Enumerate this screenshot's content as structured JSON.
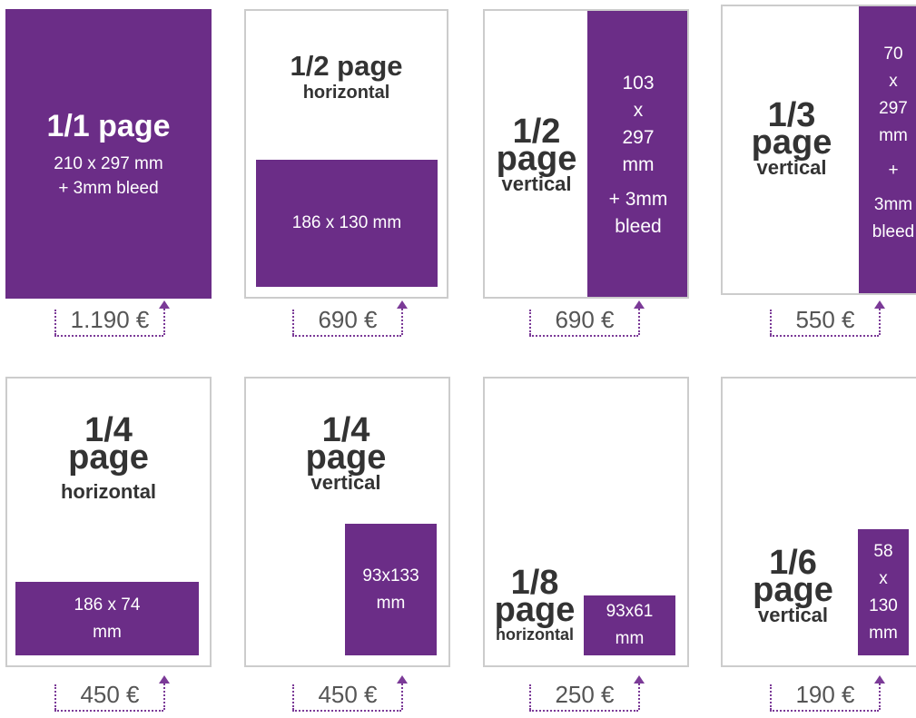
{
  "accent_color": "#6b2d87",
  "ads": [
    {
      "title": "1/1 page",
      "size_line1": "210 x 297 mm",
      "size_line2": "+ 3mm bleed",
      "price": "1.190 €"
    },
    {
      "title": "1/2 page",
      "subtitle": "horizontal",
      "size": "186 x 130 mm",
      "price": "690 €"
    },
    {
      "title_line1": "1/2",
      "title_line2": "page",
      "subtitle": "vertical",
      "size_line1": "103",
      "size_line2": "x",
      "size_line3": "297",
      "size_line4": "mm",
      "bleed_line1": "+ 3mm",
      "bleed_line2": "bleed",
      "price": "690 €"
    },
    {
      "title_line1": "1/3",
      "title_line2": "page",
      "subtitle": "vertical",
      "size_line1": "70",
      "size_line2": "x",
      "size_line3": "297",
      "size_line4": "mm",
      "bleed_line1": "+",
      "bleed_line2": "3mm",
      "bleed_line3": "bleed",
      "price": "550 €"
    },
    {
      "title_line1": "1/4",
      "title_line2": "page",
      "subtitle": "horizontal",
      "size_line1": "186 x 74",
      "size_line2": "mm",
      "price": "450 €"
    },
    {
      "title_line1": "1/4",
      "title_line2": "page",
      "subtitle": "vertical",
      "size_line1": "93x133",
      "size_line2": "mm",
      "price": "450 €"
    },
    {
      "title_line1": "1/8",
      "title_line2": "page",
      "subtitle": "horizontal",
      "size_line1": "93x61",
      "size_line2": "mm",
      "price": "250 €"
    },
    {
      "title_line1": "1/6",
      "title_line2": "page",
      "subtitle": "vertical",
      "size_line1": "58",
      "size_line2": "x",
      "size_line3": "130",
      "size_line4": "mm",
      "price": "190 €"
    }
  ]
}
